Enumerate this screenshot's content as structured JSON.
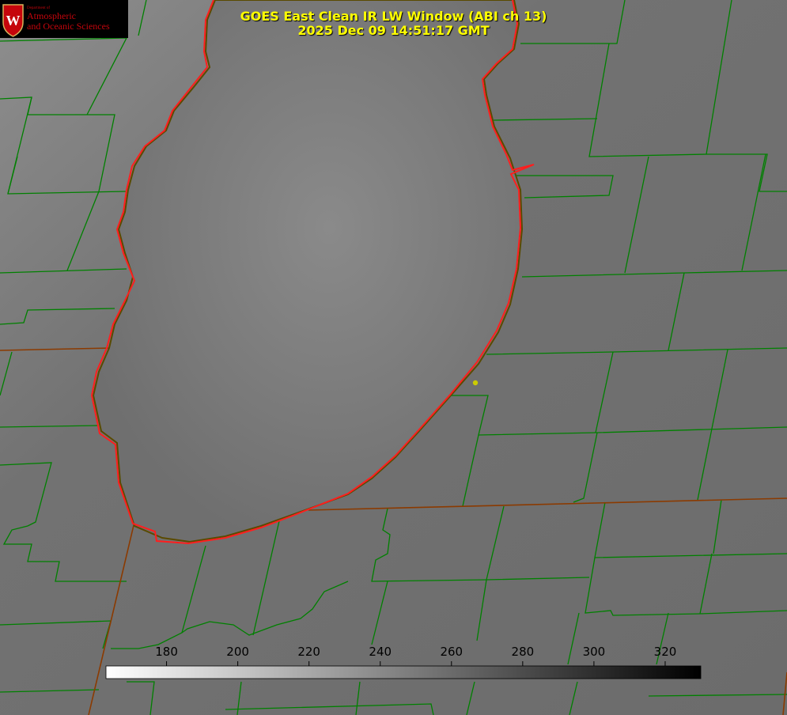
{
  "title": {
    "line1": "GOES East Clean IR LW Window (ABI ch 13)",
    "line2": "2025 Dec 09 14:51:17 GMT"
  },
  "logo": {
    "dept": "Department of",
    "line1": "Atmospheric",
    "line2": "and Oceanic Sciences",
    "crest_letter": "W",
    "crest_color": "#c5050c"
  },
  "colorbar": {
    "ticks": [
      "180",
      "200",
      "220",
      "240",
      "260",
      "280",
      "300",
      "320"
    ],
    "tick_values": [
      180,
      200,
      220,
      240,
      260,
      280,
      300,
      320
    ],
    "range": [
      163,
      330
    ],
    "low_color": "#ffffff",
    "high_color": "#000000"
  },
  "colors": {
    "county_line": "#008000",
    "state_line": "#8b3a00",
    "lake_outline": "#ff1e1e",
    "marker": "#cccc00",
    "background": "#6e6e6e"
  }
}
